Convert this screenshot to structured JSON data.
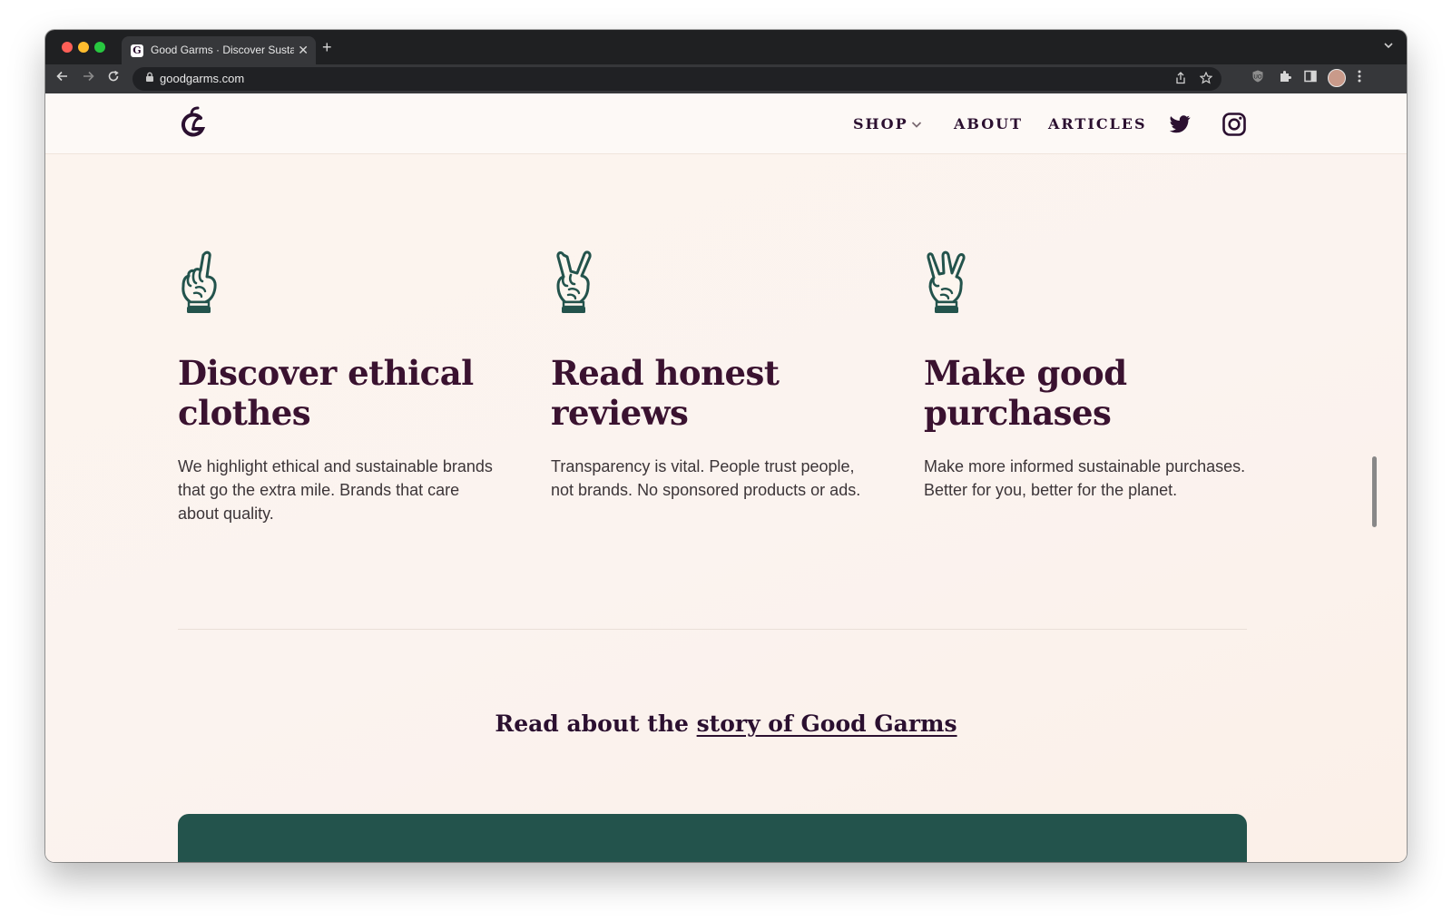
{
  "browser": {
    "tab_title": "Good Garms · Discover Sustain",
    "tab_close": "✕",
    "new_tab": "+",
    "tab_favicon": "G",
    "url": "goodgarms.com"
  },
  "site": {
    "nav": {
      "shop": "SHOP",
      "about": "ABOUT",
      "articles": "ARTICLES"
    },
    "features": [
      {
        "icon": "one-finger-hand-icon",
        "title": "Discover ethical clothes",
        "body": "We highlight ethical and sustainable brands that go the extra mile. Brands that care about quality."
      },
      {
        "icon": "two-finger-hand-icon",
        "title": "Read honest reviews",
        "body": "Transparency is vital. People trust people, not brands. No sponsored products or ads."
      },
      {
        "icon": "three-finger-hand-icon",
        "title": "Make good purchases",
        "body": "Make more informed sustainable purchases. Better for you, better for the planet."
      }
    ],
    "story": {
      "prefix": "Read about the ",
      "link": "story of Good Garms"
    }
  },
  "colors": {
    "brand_plum": "#3a1230",
    "brand_green": "#23534c",
    "page_bg": "#fcf4ee"
  }
}
